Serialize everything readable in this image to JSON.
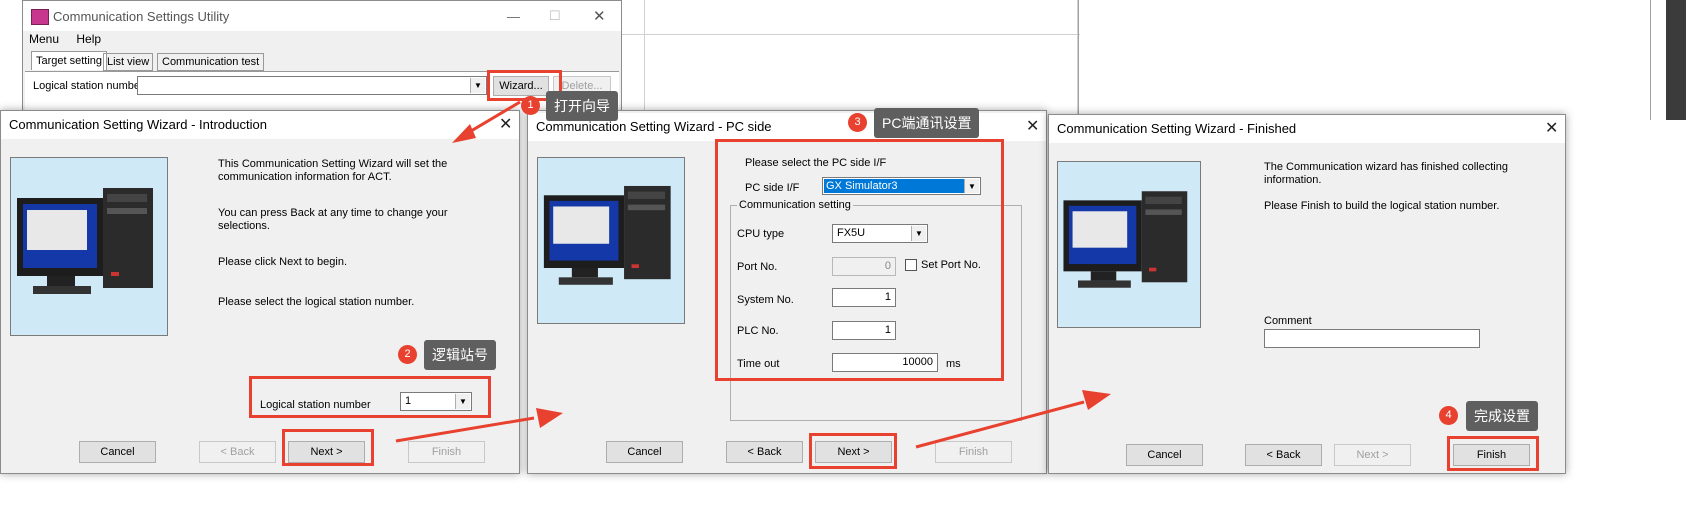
{
  "utility": {
    "title": "Communication Settings Utility",
    "menu": [
      "Menu",
      "Help"
    ],
    "tabs": [
      "Target setting",
      "List view",
      "Communication test"
    ],
    "station_label": "Logical station number",
    "wizard_button": "Wizard...",
    "delete_button": "Delete..."
  },
  "intro": {
    "title": "Communication Setting Wizard - Introduction",
    "line1": "This Communication Setting Wizard will set the",
    "line2": "communication information for ACT.",
    "line3": "You can press Back at any time to change your",
    "line4": "selections.",
    "line5": "Please click Next to begin.",
    "line6": "Please select the logical station number.",
    "station_label": "Logical station number",
    "station_value": "1",
    "cancel": "Cancel",
    "back": "< Back",
    "next": "Next >",
    "finish": "Finish"
  },
  "pcside": {
    "title": "Communication Setting Wizard - PC side",
    "prompt": "Please select the PC side I/F",
    "if_label": "PC side I/F",
    "if_value": "GX Simulator3",
    "group_label": "Communication setting",
    "cpu_label": "CPU type",
    "cpu_value": "FX5U",
    "port_label": "Port No.",
    "port_value": "0",
    "set_port_label": "Set Port No.",
    "system_label": "System No.",
    "system_value": "1",
    "plc_label": "PLC No.",
    "plc_value": "1",
    "timeout_label": "Time out",
    "timeout_value": "10000",
    "timeout_unit": "ms",
    "cancel": "Cancel",
    "back": "< Back",
    "next": "Next >",
    "finish": "Finish"
  },
  "finished": {
    "title": "Communication Setting Wizard - Finished",
    "line1": "The Communication wizard has finished collecting",
    "line2": "information.",
    "line3": "Please Finish to build the logical station number.",
    "comment_label": "Comment",
    "comment_value": "",
    "cancel": "Cancel",
    "back": "< Back",
    "next": "Next >",
    "finish": "Finish"
  },
  "annotations": {
    "step1_num": "1",
    "step1_text": "打开向导",
    "step2_num": "2",
    "step2_text": "逻辑站号",
    "step3_num": "3",
    "step3_text": "PC端通讯设置",
    "step4_num": "4",
    "step4_text": "完成设置"
  },
  "colors": {
    "accent_red": "#e8412f",
    "tooltip_bg": "#5f5f5f",
    "selection_blue": "#0078d7",
    "picture_bg": "#cfe9f6"
  }
}
